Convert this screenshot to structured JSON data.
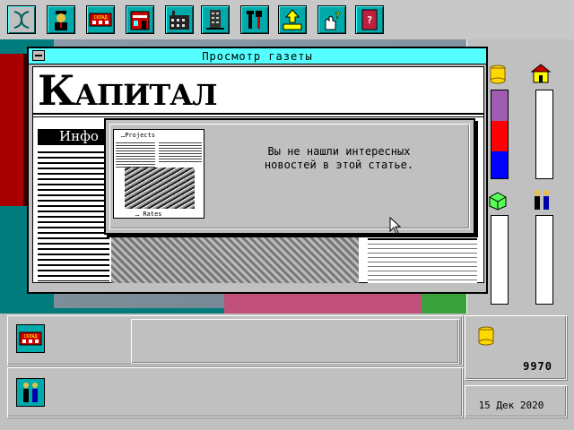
{
  "window": {
    "title": "Просмотр газеты"
  },
  "newspaper": {
    "masthead": "Капитал",
    "section_heading": "Инфо",
    "thumb_title": "…Projects",
    "thumb_caption": "… Rates"
  },
  "dialog": {
    "message": "Вы не нашли интересных\nновостей в этой статье."
  },
  "status": {
    "money": "9970",
    "date": "15 Дек 2020"
  },
  "toolbar": {
    "items": [
      {
        "icon": "dna-icon"
      },
      {
        "icon": "boss-icon"
      },
      {
        "icon": "warehouse-icon",
        "label": "СКЛАД"
      },
      {
        "icon": "shop-icon"
      },
      {
        "icon": "factory-icon"
      },
      {
        "icon": "office-building-icon"
      },
      {
        "icon": "tools-icon"
      },
      {
        "icon": "export-icon"
      },
      {
        "icon": "help-icon"
      },
      {
        "icon": "book-icon"
      }
    ]
  },
  "bottom": {
    "warehouse_label": "СКЛАД"
  },
  "colors": {
    "cyan_button": "#00aaaa",
    "title_bar": "#55ffff",
    "meter_purple": "#a05cb0",
    "meter_red": "#ff0000",
    "meter_blue": "#0000ff"
  },
  "meters": {
    "segments": [
      {
        "color": "#a05cb0",
        "fraction": 0.35
      },
      {
        "color": "#ff0000",
        "fraction": 0.34
      },
      {
        "color": "#0000ff",
        "fraction": 0.31
      }
    ]
  }
}
